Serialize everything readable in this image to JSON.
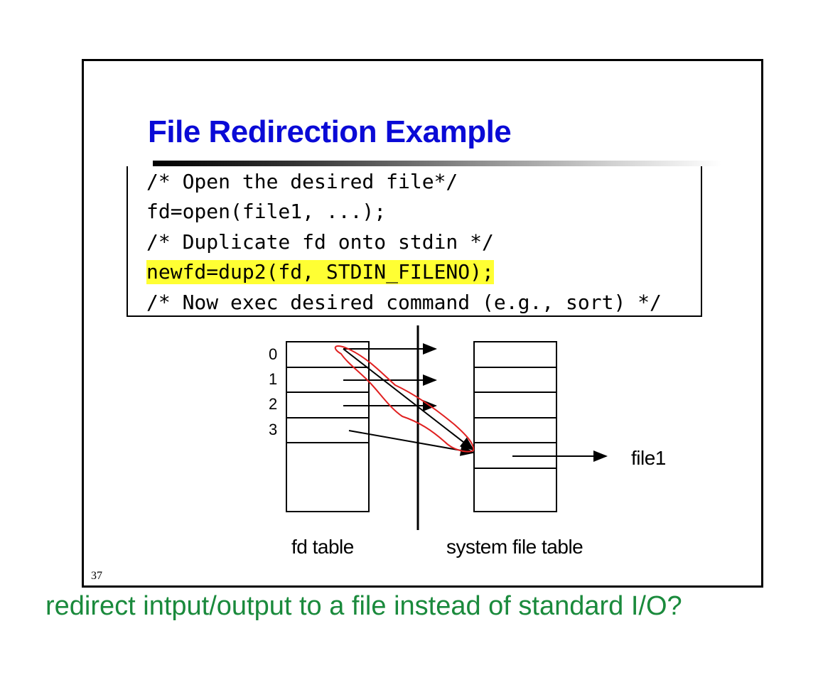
{
  "slide": {
    "title": "File Redirection Example",
    "code_lines": [
      "/* Open the desired file*/",
      "fd=open(file1, ...);",
      "/* Duplicate fd onto stdin */",
      "newfd=dup2(fd, STDIN_FILENO);",
      "/* Now exec desired command (e.g., sort) */"
    ],
    "highlighted_line_index": 3,
    "diagram": {
      "fd_indices": [
        "0",
        "1",
        "2",
        "3"
      ],
      "fd_table_label": "fd table",
      "system_table_label": "system file table",
      "file_label": "file1"
    },
    "slide_number": "37"
  },
  "caption": "redirect intput/output to a file instead of standard I/O?",
  "colors": {
    "title": "#0a0ad6",
    "highlight": "#ffff33",
    "annotation": "#e02020",
    "caption": "#1a8a3c"
  }
}
